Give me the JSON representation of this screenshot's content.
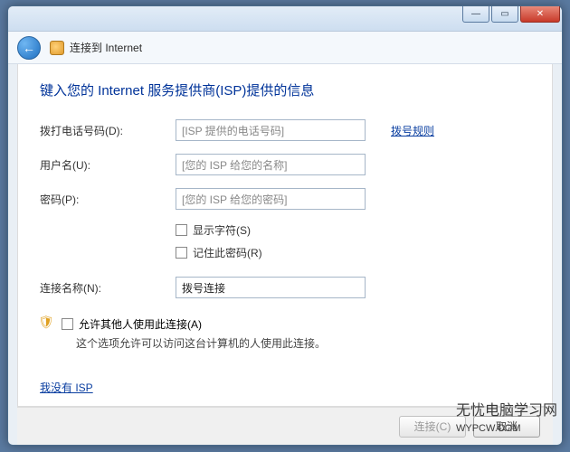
{
  "titlebar": {
    "min": "—",
    "max": "▭",
    "close": "✕"
  },
  "nav": {
    "back": "←",
    "title": "连接到 Internet"
  },
  "heading": "键入您的 Internet 服务提供商(ISP)提供的信息",
  "fields": {
    "phone_label": "拨打电话号码(D):",
    "phone_placeholder": "[ISP 提供的电话号码]",
    "dial_rules_link": "拨号规则",
    "user_label": "用户名(U):",
    "user_placeholder": "[您的 ISP 给您的名称]",
    "pass_label": "密码(P):",
    "pass_placeholder": "[您的 ISP 给您的密码]",
    "show_chars": "显示字符(S)",
    "remember": "记住此密码(R)",
    "conn_name_label": "连接名称(N):",
    "conn_name_value": "拨号连接",
    "allow_others": "允许其他人使用此连接(A)",
    "allow_desc": "这个选项允许可以访问这台计算机的人使用此连接。",
    "no_isp": "我没有 ISP"
  },
  "footer": {
    "connect": "连接(C)",
    "cancel": "取消"
  },
  "watermark": "无忧电脑学习网\nWYPCW.COM"
}
